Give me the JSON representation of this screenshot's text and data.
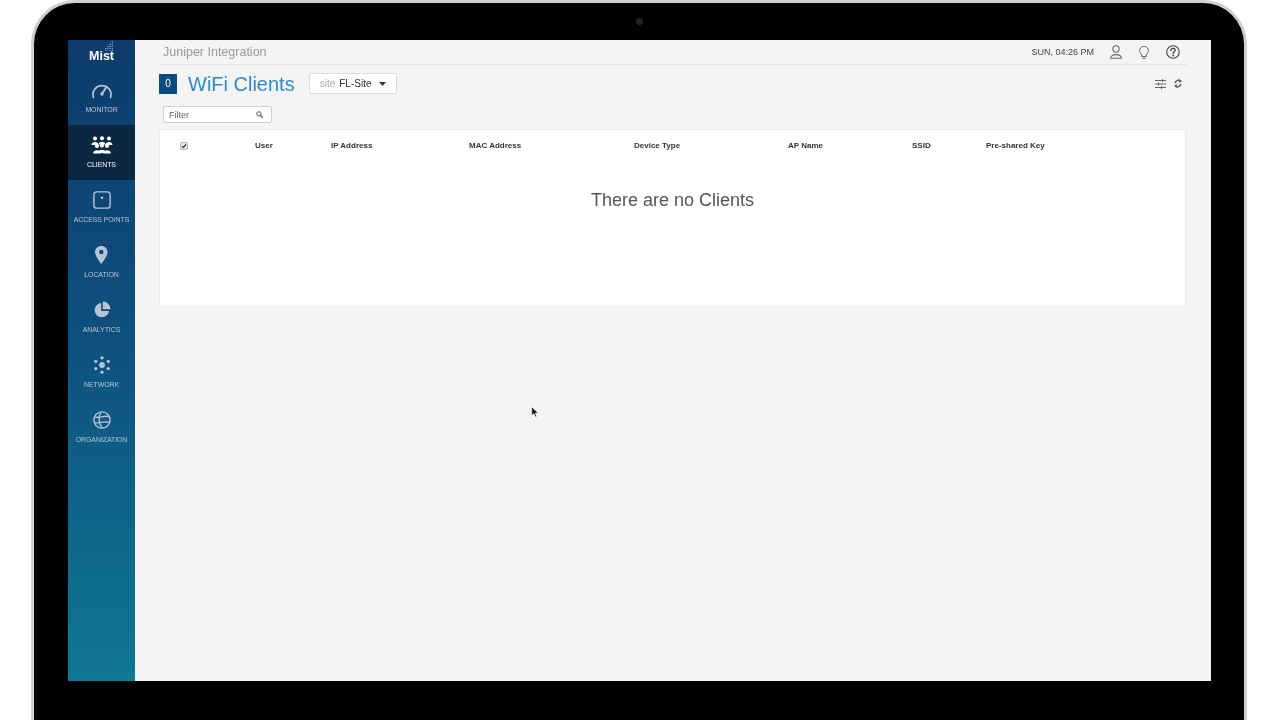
{
  "sidebar": {
    "logo": "Mist",
    "items": [
      {
        "label": "MONITOR",
        "selected": false
      },
      {
        "label": "CLIENTS",
        "selected": true
      },
      {
        "label": "ACCESS POINTS",
        "selected": false
      },
      {
        "label": "LOCATION",
        "selected": false
      },
      {
        "label": "ANALYTICS",
        "selected": false
      },
      {
        "label": "NETWORK",
        "selected": false
      },
      {
        "label": "ORGANIZATION",
        "selected": false
      }
    ]
  },
  "header": {
    "organization": "Juniper Integration",
    "time": "SUN, 04:26 PM"
  },
  "page": {
    "count": "0",
    "title": "WiFi Clients",
    "site_selector": {
      "prefix": "site",
      "value": "FL-Site"
    }
  },
  "filter": {
    "placeholder": "Filter"
  },
  "table": {
    "select_all": {
      "checked": true
    },
    "columns": [
      "User",
      "IP Address",
      "MAC Address",
      "Device Type",
      "AP Name",
      "SSID",
      "Pre-shared Key"
    ],
    "empty_message": "There are no Clients"
  }
}
